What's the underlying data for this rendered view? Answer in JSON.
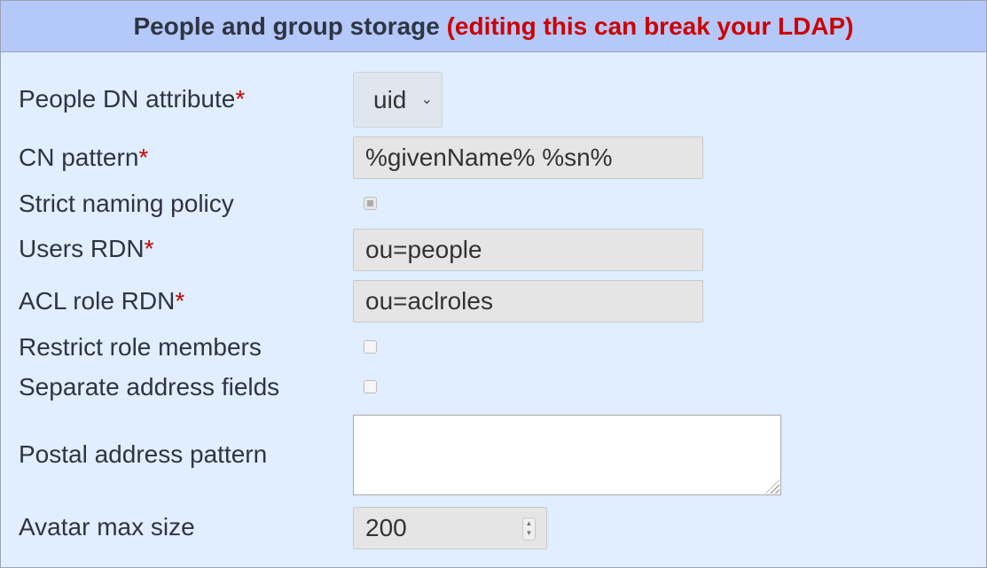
{
  "header": {
    "title": "People and group storage",
    "warning": "(editing this can break your LDAP)"
  },
  "required_marker": "*",
  "fields": {
    "people_dn": {
      "label": "People DN attribute",
      "value": "uid"
    },
    "cn_pattern": {
      "label": "CN pattern",
      "value": "%givenName% %sn%"
    },
    "strict_naming": {
      "label": "Strict naming policy",
      "checked": true,
      "disabled": true
    },
    "users_rdn": {
      "label": "Users RDN",
      "value": "ou=people"
    },
    "acl_role_rdn": {
      "label": "ACL role RDN",
      "value": "ou=aclroles"
    },
    "restrict_role": {
      "label": "Restrict role members",
      "checked": false
    },
    "separate_address": {
      "label": "Separate address fields",
      "checked": false
    },
    "postal_address": {
      "label": "Postal address pattern",
      "value": ""
    },
    "avatar_max": {
      "label": "Avatar max size",
      "value": "200"
    }
  },
  "icons": {
    "select_chevron": "chevron-down-icon",
    "spin_up": "spin-up-icon",
    "spin_down": "spin-down-icon",
    "resize_grip": "resize-grip-icon"
  },
  "colors": {
    "header_bg": "#b4c8fa",
    "panel_bg": "#e0eeff",
    "warning": "#cc0000",
    "input_bg": "#e5e5e5"
  }
}
